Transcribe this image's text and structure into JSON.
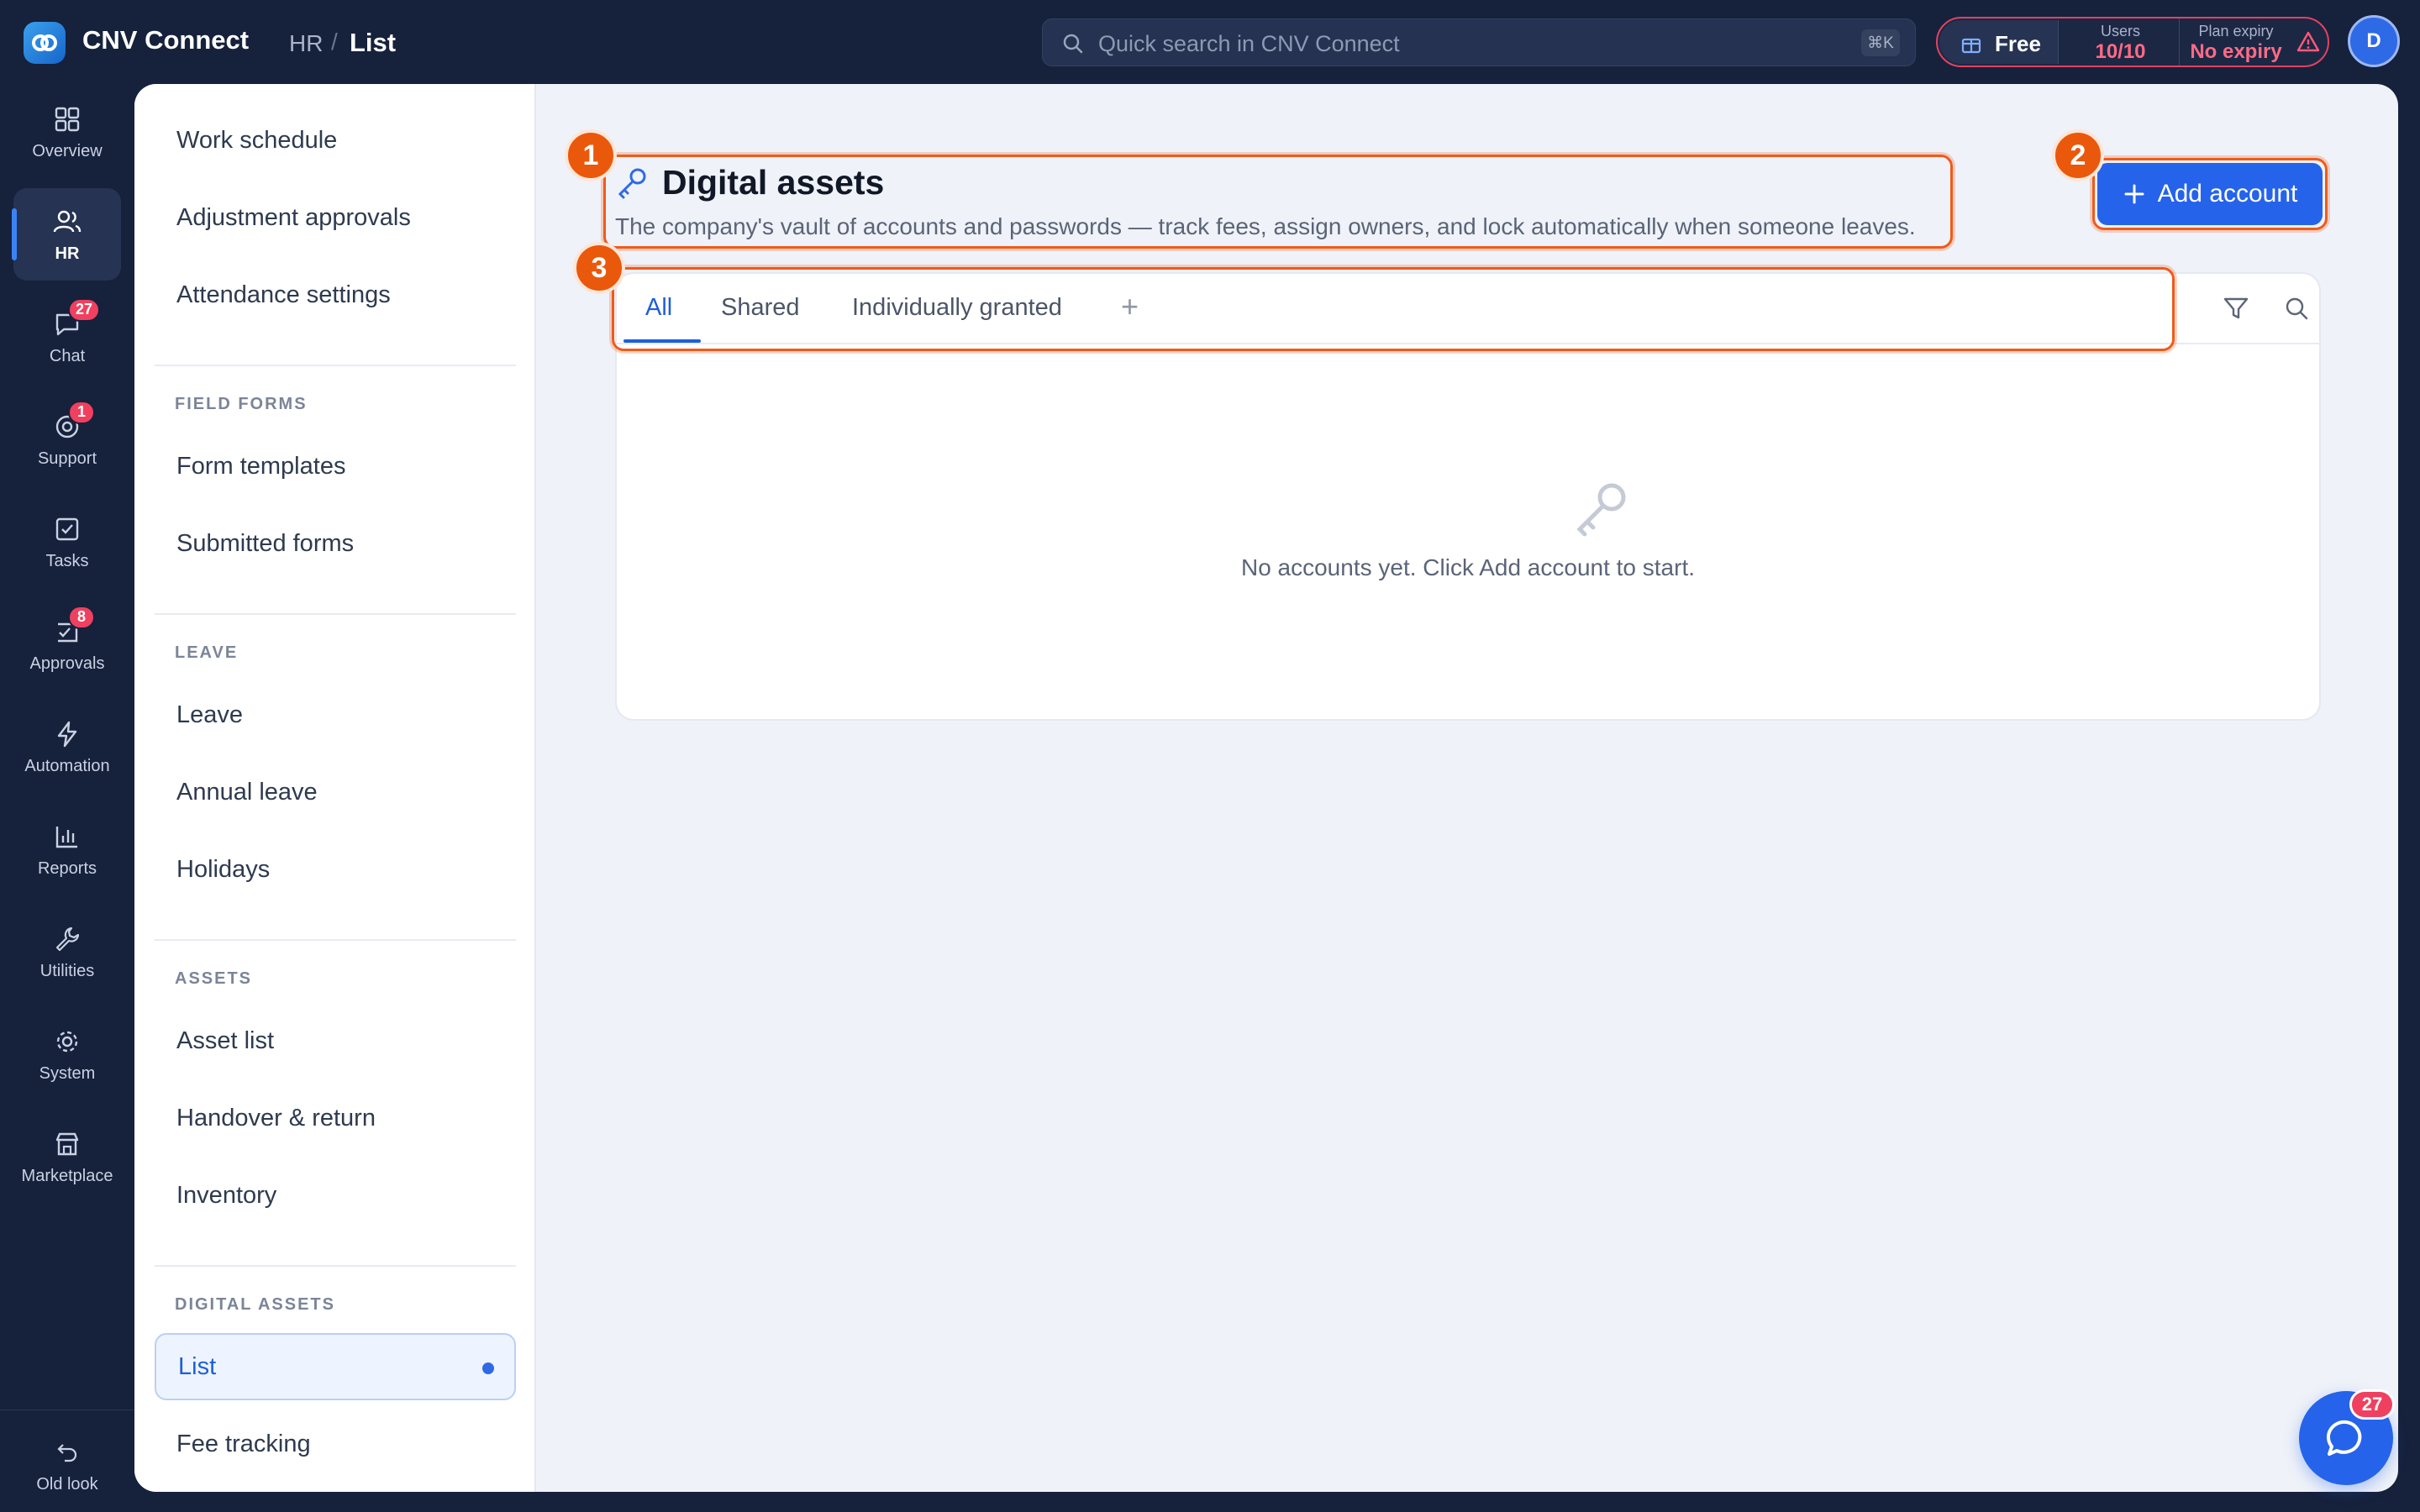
{
  "app": {
    "title": "CNV Connect"
  },
  "breadcrumb": {
    "parent": "HR",
    "separator": "/",
    "current": "List"
  },
  "search": {
    "placeholder": "Quick search in CNV Connect",
    "shortcut": "⌘K"
  },
  "plan": {
    "name": "Free",
    "users_caption": "Users",
    "users_value": "10/10",
    "expiry_caption": "Plan expiry",
    "expiry_value": "No expiry"
  },
  "user": {
    "initial": "D"
  },
  "rail": {
    "items": [
      {
        "label": "Overview",
        "icon": "grid-icon"
      },
      {
        "label": "HR",
        "icon": "users-icon",
        "active": true
      },
      {
        "label": "Chat",
        "icon": "chat-icon",
        "badge": "27"
      },
      {
        "label": "Support",
        "icon": "lifebuoy-icon",
        "badge": "1"
      },
      {
        "label": "Tasks",
        "icon": "checkbox-icon"
      },
      {
        "label": "Approvals",
        "icon": "approval-icon",
        "badge": "8"
      },
      {
        "label": "Automation",
        "icon": "lightning-icon"
      },
      {
        "label": "Reports",
        "icon": "bar-chart-icon"
      },
      {
        "label": "Utilities",
        "icon": "wrench-icon"
      },
      {
        "label": "System",
        "icon": "gear-icon"
      },
      {
        "label": "Marketplace",
        "icon": "store-icon"
      }
    ],
    "old_look": "Old look"
  },
  "subnav": {
    "top_items": [
      "Work schedule",
      "Adjustment approvals",
      "Attendance settings"
    ],
    "field_forms": {
      "heading": "FIELD FORMS",
      "items": [
        "Form templates",
        "Submitted forms"
      ]
    },
    "leave": {
      "heading": "LEAVE",
      "items": [
        "Leave",
        "Annual leave",
        "Holidays"
      ]
    },
    "assets": {
      "heading": "ASSETS",
      "items": [
        "Asset list",
        "Handover & return",
        "Inventory"
      ]
    },
    "digital_assets": {
      "heading": "DIGITAL ASSETS",
      "items": [
        "List",
        "Fee tracking"
      ],
      "active": "List"
    }
  },
  "page": {
    "title": "Digital assets",
    "description": "The company's vault of accounts and passwords — track fees, assign owners, and lock automatically when someone leaves.",
    "add_button": "Add account",
    "tabs": [
      "All",
      "Shared",
      "Individually granted"
    ],
    "active_tab": "All",
    "tab_add": "+",
    "empty_message": "No accounts yet. Click Add account to start."
  },
  "markers": [
    "1",
    "2",
    "3"
  ],
  "chat_fab": {
    "badge": "27"
  },
  "colors": {
    "accent": "#2563eb",
    "marker": "#ea580c",
    "badge": "#ef4060",
    "sidebar_bg": "#16213c"
  }
}
